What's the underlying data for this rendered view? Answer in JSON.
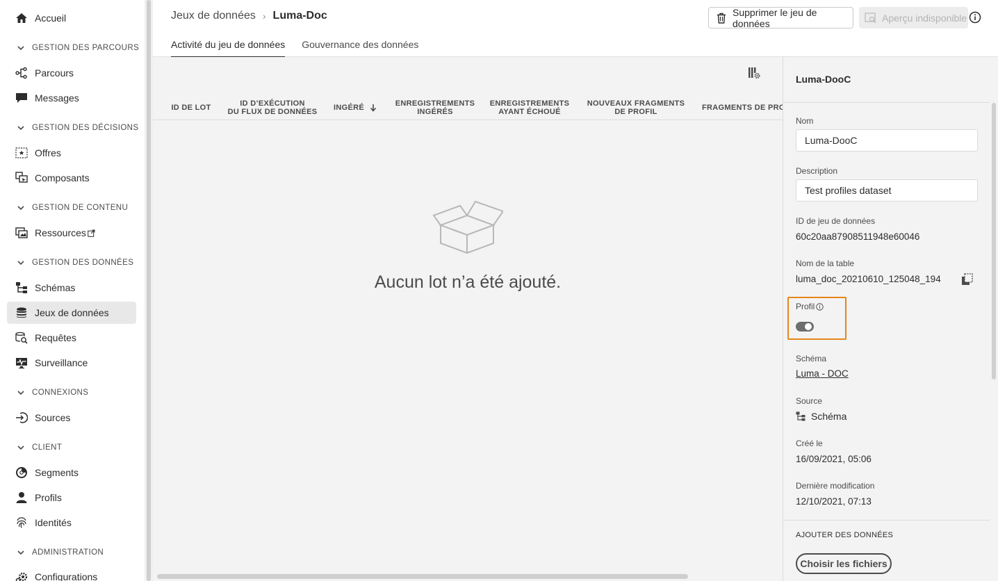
{
  "sidebar": {
    "home": "Accueil",
    "sections": {
      "parcours": "GESTION DES PARCOURS",
      "decisions": "GESTION DES DÉCISIONS",
      "contenu": "GESTION DE CONTENU",
      "donnees": "GESTION DES DONNÉES",
      "connexions": "CONNEXIONS",
      "client": "CLIENT",
      "admin": "ADMINISTRATION"
    },
    "items": {
      "parcours": "Parcours",
      "messages": "Messages",
      "offres": "Offres",
      "composants": "Composants",
      "ressources": "Ressources",
      "schemas": "Schémas",
      "jeux": "Jeux de données",
      "requetes": "Requêtes",
      "surveillance": "Surveillance",
      "sources": "Sources",
      "segments": "Segments",
      "profils": "Profils",
      "identites": "Identités",
      "configurations": "Configurations"
    },
    "active_item": "Jeux de données"
  },
  "header": {
    "breadcrumb_parent": "Jeux de données",
    "breadcrumb_current": "Luma-Doc",
    "delete_button": "Supprimer le jeu de données",
    "preview_button": "Aperçu indisponible"
  },
  "tabs": {
    "activity": "Activité du jeu de données",
    "governance": "Gouvernance des données"
  },
  "table": {
    "columns": {
      "batch_id": "ID DE LOT",
      "run_id_l1": "ID D’EXÉCUTION",
      "run_id_l2": "DU FLUX DE DONNÉES",
      "ingested": "INGÉRÉ",
      "rec_ingested_l1": "ENREGISTREMENTS",
      "rec_ingested_l2": "INGÉRÉS",
      "rec_failed_l1": "ENREGISTREMENTS",
      "rec_failed_l2": "AYANT ÉCHOUÉ",
      "new_frag_l1": "NOUVEAUX FRAGMENTS",
      "new_frag_l2": "DE PROFIL",
      "frag": "FRAGMENTS DE PROF"
    },
    "empty_message": "Aucun lot n’a été ajouté."
  },
  "panel": {
    "title": "Luma-DooC",
    "name_label": "Nom",
    "name_value": "Luma-DooC",
    "description_label": "Description",
    "description_value": "Test profiles dataset",
    "dataset_id_label": "ID de jeu de données",
    "dataset_id_value": "60c20aa87908511948e60046",
    "table_name_label": "Nom de la table",
    "table_name_value": "luma_doc_20210610_125048_194",
    "profile_label": "Profil",
    "profile_enabled": true,
    "schema_label": "Schéma",
    "schema_value": "Luma - DOC",
    "source_label": "Source",
    "source_value": "Schéma",
    "created_label": "Créé le",
    "created_value": "16/09/2021, 05:06",
    "modified_label": "Dernière modification",
    "modified_value": "12/10/2021, 07:13",
    "add_data_title": "AJOUTER DES DONNÉES",
    "choose_files_button": "Choisir les fichiers"
  },
  "colors": {
    "highlight": "#e68619",
    "active_bg": "#e8e8e8",
    "panel_bg": "#f3f3f3"
  }
}
